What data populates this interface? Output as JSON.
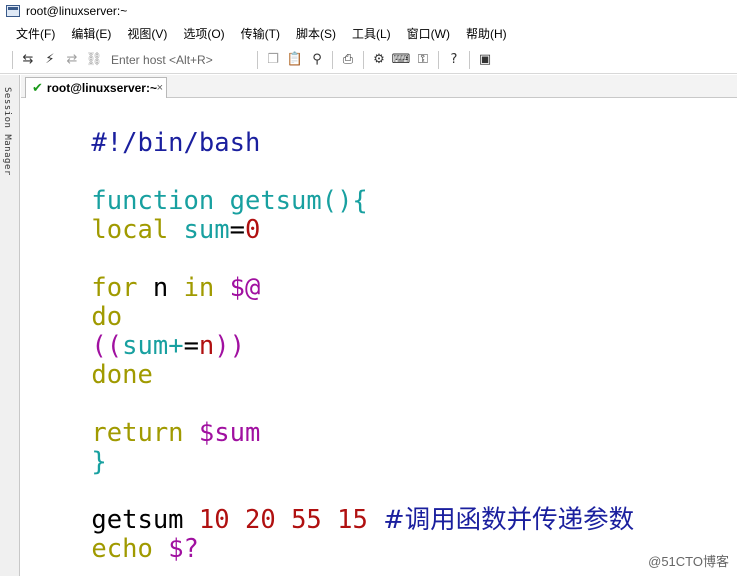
{
  "window": {
    "title": "root@linuxserver:~"
  },
  "menu": [
    "文件(F)",
    "编辑(E)",
    "视图(V)",
    "选项(O)",
    "传输(T)",
    "脚本(S)",
    "工具(L)",
    "窗口(W)",
    "帮助(H)"
  ],
  "toolbar": {
    "host_placeholder": "Enter host <Alt+R>"
  },
  "sidebar": {
    "label": "Session Manager"
  },
  "tab": {
    "label": "root@linuxserver:~"
  },
  "terminal": {
    "line1": "#!/bin/bash",
    "line3_kw": "function",
    "line3_fn": "getsum(){",
    "line4_kw": "local",
    "line4_var": "sum",
    "line4_eq": "=",
    "line4_val": "0",
    "line6_for": "for",
    "line6_n": "n",
    "line6_in": "in",
    "line6_args": "$@",
    "line7": "do",
    "line8_open": "((",
    "line8_sum": "sum+",
    "line8_eq": "=",
    "line8_n": "n",
    "line8_close": "))",
    "line9": "done",
    "line11_kw": "return",
    "line11_var": "$sum",
    "line12": "}",
    "line14_cmd": "getsum",
    "line14_a1": "10",
    "line14_a2": "20",
    "line14_a3": "55",
    "line14_a4": "15",
    "line14_comment": "#调用函数并传递参数",
    "line15_cmd": "echo",
    "line15_var": "$?"
  },
  "watermark": "@51CTO博客",
  "colors": {
    "keyword_olive": "#a09a00",
    "function_cyan": "#18a0a0",
    "shebang_blue": "#1a1f9e",
    "number_red": "#b01010",
    "variable_magenta": "#a010a0"
  }
}
